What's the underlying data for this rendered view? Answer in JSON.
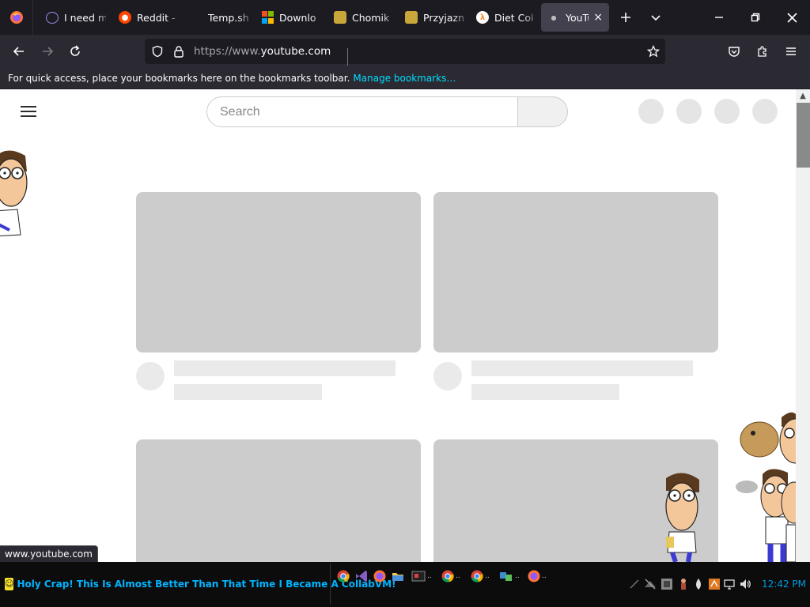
{
  "browser": {
    "tabs": [
      {
        "label": "I need m",
        "icon": "proton-icon",
        "color": "#6e4ff6"
      },
      {
        "label": "Reddit -",
        "icon": "reddit-icon",
        "color": "#ff4500"
      },
      {
        "label": "Temp.sh | Re",
        "icon": "blank-icon",
        "color": "#1c1b22"
      },
      {
        "label": "Downlo",
        "icon": "microsoft-icon",
        "color": "#f25022"
      },
      {
        "label": "Chomik",
        "icon": "chomikuj-icon",
        "color": "#c8a63a"
      },
      {
        "label": "Przyjazny",
        "icon": "chomikuj-icon",
        "color": "#c8a63a"
      },
      {
        "label": "Diet Cok",
        "icon": "halflife-icon",
        "color": "#f28c28"
      }
    ],
    "active_tab": {
      "label": "YouTu",
      "close": "×"
    },
    "url": {
      "scheme": "https://www.",
      "host": "youtube.com"
    },
    "bookmarks_message": "For quick access, place your bookmarks here on the bookmarks toolbar.",
    "manage_bookmarks": "Manage bookmarks…",
    "status_url": "www.youtube.com"
  },
  "youtube": {
    "search_placeholder": "Search"
  },
  "taskbar": {
    "title": "Holy Crap! This Is Almost Better Than That Time I Became A CollabVM!",
    "clock": "12:42 PM"
  },
  "colors": {
    "tab_strip": "#1c1b22",
    "toolbar": "#2b2a33",
    "link": "#00ddff",
    "skeleton": "#cccccc",
    "taskbar_title": "#00b4ff"
  }
}
